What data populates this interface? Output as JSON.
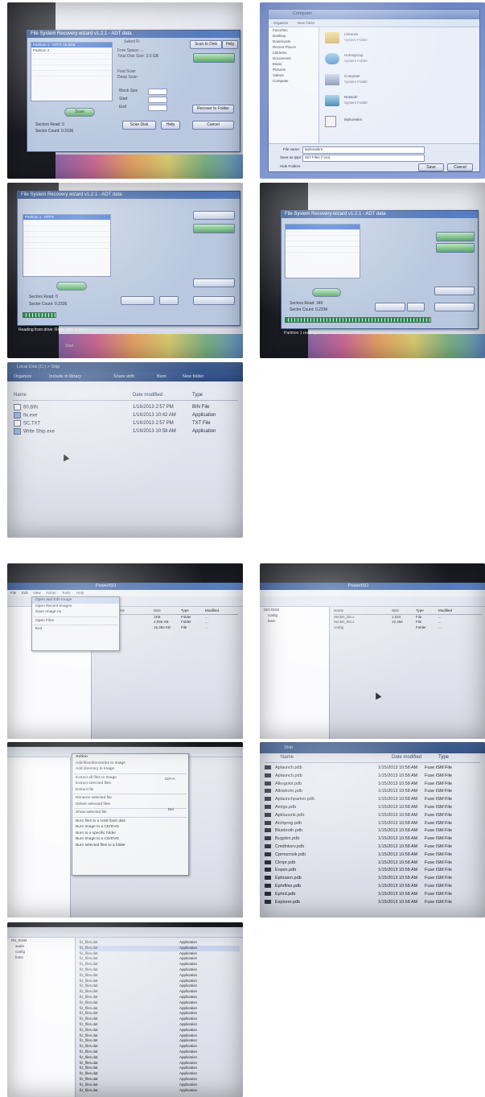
{
  "grid_top": {
    "panel1": {
      "window_title": "File System Recovery wizard v1.2.1 - ADT data",
      "header_tab": "Select Fi",
      "top_right_buttons": [
        "Scan to Disk",
        "Help"
      ],
      "list_items": [
        "Partition 1 - NTFS  15.6GB",
        "Partition 2",
        "",
        "",
        "",
        "",
        "",
        "",
        ""
      ],
      "info_lines": [
        "Free Space: ...",
        "Total Disk Size: 3.5 GB",
        "Volume Label: ..."
      ],
      "radio_group": [
        "Fast Scan",
        "Deep Scan"
      ],
      "option_labels": [
        "Block Size",
        "Start",
        "End",
        "Sectors"
      ],
      "field_values": [
        "512",
        "0",
        "...",
        "..."
      ],
      "buttons": [
        "Scan Disk",
        "Help",
        "Recover to Folder",
        "Cancel"
      ],
      "status_lines": [
        "Sectors Read: 0",
        "Sector Count: 0.2336"
      ],
      "small_green_button": "Scan"
    },
    "panel2": {
      "breadcrumb": "Computer",
      "toolbar": [
        "Organize",
        "New folder"
      ],
      "nav_items": [
        "Favorites",
        "Desktop",
        "Downloads",
        "Recent Places",
        "Libraries",
        "Documents",
        "Music",
        "Pictures",
        "Videos",
        "Computer"
      ],
      "folders": [
        {
          "name": "Libraries",
          "sub": "System Folder"
        },
        {
          "name": "Homegroup",
          "sub": "System Folder"
        },
        {
          "name": "Computer",
          "sub": "System Folder"
        },
        {
          "name": "Network",
          "sub": "System Folder"
        },
        {
          "name": "lephonekrn",
          "sub": ""
        }
      ],
      "file_name_label": "File name:",
      "file_name_value": "lephonekrn",
      "save_type_label": "Save as type:",
      "save_type_value": "ISO Files (*.iso)",
      "buttons": [
        "Save",
        "Cancel"
      ],
      "hide_folders": "Hide Folders"
    },
    "panel3": {
      "window_title": "File System Recovery wizard v1.2.1 - ADT data",
      "list_items": [
        "Partition 1 - NTFS",
        "",
        "",
        "",
        "",
        "",
        "",
        "",
        ""
      ],
      "status_lines": [
        "Sectors Read: 0",
        "Sector Count: 0.2336"
      ],
      "progress_label": "Reading from drive: Right click to abort",
      "taskbar_label": "Start"
    },
    "panel4": {
      "window_title": "File System Recovery wizard v1.2.1 - ADT data",
      "status_lines": [
        "Sectors Read: 346",
        "Sector Count: 0.2336"
      ],
      "progress_label": "Partition 1 reading sectors from disk to ISO"
    },
    "panel5": {
      "path": "Local Disk (C:) > Ship",
      "toolbar": [
        "Organize",
        "Include in library",
        "Share with",
        "Burn",
        "New folder"
      ],
      "columns": [
        "Name",
        "Date modified",
        "Type"
      ],
      "files": [
        {
          "name": "60.BIN",
          "date": "1/16/2013 2:57 PM",
          "type": "BIN File",
          "icon": "file"
        },
        {
          "name": "fix.exe",
          "date": "1/16/2013 10:42 AM",
          "type": "Application",
          "icon": "app"
        },
        {
          "name": "SC.TXT",
          "date": "1/16/2013 2:57 PM",
          "type": "TXT File",
          "icon": "file"
        },
        {
          "name": "Write Ship.exe",
          "date": "1/16/2013 10:58 AM",
          "type": "Application",
          "icon": "app"
        }
      ]
    }
  },
  "grid_bottom": {
    "panel6": {
      "window_title": "PowerISO",
      "menubar": [
        "File",
        "Edit",
        "View",
        "Action",
        "Tools",
        "Help"
      ],
      "menu_items": [
        "Open and Edit Image",
        "Open Recent Images",
        "Save Image As",
        "",
        "Open Files",
        "",
        "Exit"
      ],
      "columns": [
        "Name",
        "Size",
        "Type",
        "Modified"
      ],
      "rows": [
        {
          "name": "",
          "size": "1KB",
          "type": "Folder",
          "mod": "..."
        },
        {
          "name": "",
          "size": "4,096 KB",
          "type": "Folder",
          "mod": "..."
        },
        {
          "name": "",
          "size": "16,384 KB",
          "type": "File",
          "mod": "..."
        }
      ]
    },
    "panel7": {
      "window_title": "PowerISO",
      "tree": [
        "ISO DISK",
        "config",
        "boot"
      ],
      "columns": [
        "Name",
        "Size",
        "Type",
        "Modified"
      ],
      "rows": [
        {
          "name": "Seckin_bin.x",
          "size": "1,024",
          "type": "File",
          "mod": "..."
        },
        {
          "name": "Seckin_bin.x",
          "size": "12,456",
          "type": "File",
          "mod": "..."
        },
        {
          "name": "config",
          "size": "",
          "type": "Folder",
          "mod": "..."
        }
      ]
    },
    "panel8": {
      "menu_title": "Action",
      "menu_items": [
        "Add files/directories to Image",
        "Add directory to Image",
        "",
        "Extract all files to Image",
        "Extract selected files",
        "Extract file",
        "",
        "Rename selected file",
        "Delete selected files",
        "",
        "Show selected file",
        "",
        "Burn files to a USB flash disk",
        "Burn Image to a CD/DVD",
        "Burn to a specific folder",
        "Burn Image to a CD/DVD",
        "Burn selected files to a folder"
      ],
      "shortcuts": [
        "Ctrl+A",
        "",
        "",
        "",
        "",
        "Del",
        "",
        "",
        "",
        "",
        "",
        "",
        "",
        "",
        "",
        "",
        ""
      ]
    },
    "panel9": {
      "breadcrumb": "Ship",
      "columns": [
        "Name",
        "Date modified",
        "Type"
      ],
      "files": [
        "Aplaunch.pdb",
        "Aplaunch.pdb",
        "Alkogolol.pdb",
        "Alkiwkom.pdb",
        "Aplaunchparker.pdb",
        "Amigo.pdb",
        "Apkluuunk.pdb",
        "Archprog.pdb",
        "Bluetooth.pdb",
        "Bugskin.pdb",
        "Cmdlnksrv.pdb",
        "Cprmsmsik.pdb",
        "Clrnpr.pdb",
        "Eopsn.pdb",
        "Ephrasm.pdb",
        "Ephrfiles.pdb",
        "Ephrd.pdb",
        "Explorer.pdb"
      ],
      "date_value": "1/15/2013 10:58 AM",
      "type_value": "Fuse ISM File"
    },
    "panel10": {
      "window_title": "PowerISO",
      "tree": [
        "PH_ROM",
        "audio",
        "config",
        "fonts"
      ],
      "row_count": 28,
      "row_name": "fiz_files.dat",
      "row_type": "Application"
    }
  }
}
